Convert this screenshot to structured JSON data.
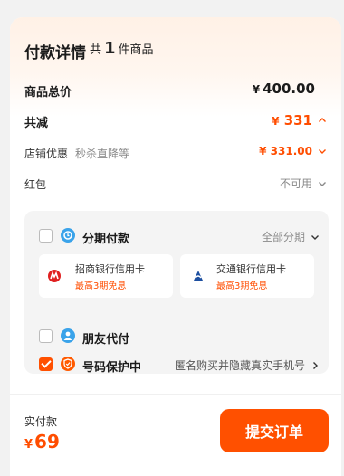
{
  "header": {
    "title": "付款详情",
    "count_prefix": "共",
    "count_num": "1",
    "count_suffix": "件商品"
  },
  "summary": {
    "total_label": "商品总价",
    "total_currency": "¥",
    "total_value": "400.00",
    "discount_label": "共减",
    "discount_currency": "¥",
    "discount_value": "331",
    "store_label": "店铺优惠",
    "store_note": "秒杀直降等",
    "store_value": "¥ 331.00",
    "redpacket_label": "红包",
    "redpacket_value": "不可用"
  },
  "payment": {
    "installment_label": "分期付款",
    "installment_action": "全部分期",
    "installment_checked": false,
    "banks": [
      {
        "name": "招商银行信用卡",
        "sub": "最高3期免息"
      },
      {
        "name": "交通银行信用卡",
        "sub": "最高3期免息"
      }
    ],
    "friend_label": "朋友代付",
    "friend_checked": false,
    "privacy_label": "号码保护中",
    "privacy_note": "匿名购买并隐藏真实手机号",
    "privacy_checked": true
  },
  "footer": {
    "paid_label": "实付款",
    "paid_currency": "¥",
    "paid_value": "69",
    "submit_label": "提交订单"
  },
  "colors": {
    "accent": "#ff5000",
    "accent_text": "#ff4d00"
  }
}
